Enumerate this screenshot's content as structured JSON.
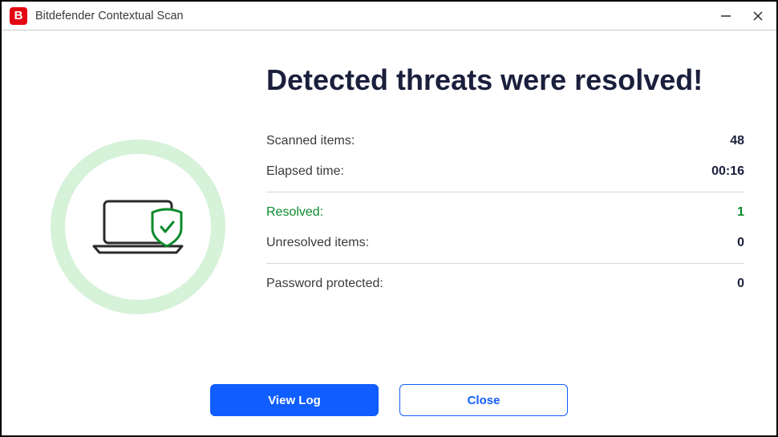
{
  "titlebar": {
    "logo_letter": "B",
    "title": "Bitdefender Contextual Scan"
  },
  "headline": "Detected threats were resolved!",
  "stats": {
    "scanned_label": "Scanned items:",
    "scanned_value": "48",
    "elapsed_label": "Elapsed time:",
    "elapsed_value": "00:16",
    "resolved_label": "Resolved:",
    "resolved_value": "1",
    "unresolved_label": "Unresolved items:",
    "unresolved_value": "0",
    "pwdprot_label": "Password protected:",
    "pwdprot_value": "0"
  },
  "buttons": {
    "view_log": "View Log",
    "close": "Close"
  }
}
